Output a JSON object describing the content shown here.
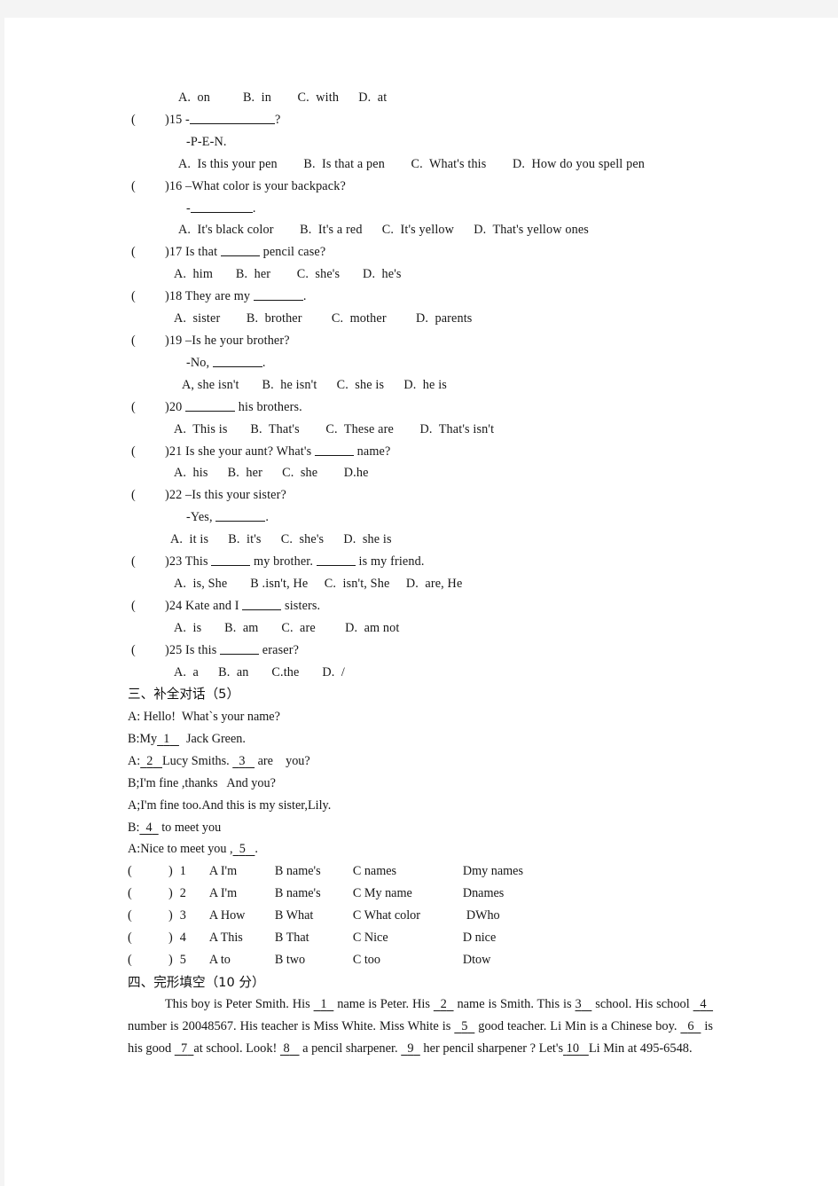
{
  "document": {
    "type": "english-exam-worksheet",
    "page_background": "#ffffff",
    "canvas_background": "#f4f4f4",
    "text_color": "#161616"
  },
  "section_two_tail": {
    "q14_options": "A.  on          B.  in        C.  with      D.  at",
    "questions": [
      {
        "num": "15",
        "paren_open": "(",
        "paren_close": ")",
        "stem_prefix": "15 -",
        "stem_suffix": "?",
        "sub_line": "-P-E-N.",
        "options": "A.  Is this your pen        B.  Is that a pen        C.  What's this        D.  How do you spell pen"
      },
      {
        "num": "16",
        "paren_open": "(",
        "paren_close": ")",
        "stem": "16 –What color is your backpack?",
        "sub_prefix": "-",
        "sub_suffix": ".",
        "options": "A.  It's black color        B.  It's a red      C.  It's yellow      D.  That's yellow ones"
      },
      {
        "num": "17",
        "paren_open": "(",
        "paren_close": ")",
        "stem_prefix": "17 Is that ",
        "stem_suffix": " pencil case?",
        "options": "A.  him       B.  her        C.  she's       D.  he's"
      },
      {
        "num": "18",
        "paren_open": "(",
        "paren_close": ")",
        "stem_prefix": "18 They are my ",
        "stem_suffix": ".",
        "options": "A.  sister        B.  brother         C.  mother         D.  parents"
      },
      {
        "num": "19",
        "paren_open": "(",
        "paren_close": ")",
        "stem": "19 –Is he your brother?",
        "sub_prefix": "-No, ",
        "sub_suffix": ".",
        "options": "A, she isn't       B.  he isn't      C.  she is      D.  he is"
      },
      {
        "num": "20",
        "paren_open": "(",
        "paren_close": ")",
        "stem_prefix": "20 ",
        "stem_suffix": " his brothers.",
        "options": "A.  This is       B.  That's        C.  These are        D.  That's isn't"
      },
      {
        "num": "21",
        "paren_open": "(",
        "paren_close": ")",
        "stem_prefix": "21 Is she your aunt? What's ",
        "stem_suffix": " name?",
        "options": "A.  his      B.  her      C.  she        D.he"
      },
      {
        "num": "22",
        "paren_open": "(",
        "paren_close": ")",
        "stem": "22 –Is this your sister?",
        "sub_prefix": "-Yes, ",
        "sub_suffix": ".",
        "options": "A.  it is      B.  it's      C.  she's      D.  she is"
      },
      {
        "num": "23",
        "paren_open": "(",
        "paren_close": ")",
        "stem_prefix": "23 This ",
        "stem_mid": " my brother. ",
        "stem_suffix": " is my friend.",
        "options": "A.  is, She       B .isn't, He     C.  isn't, She     D.  are, He"
      },
      {
        "num": "24",
        "paren_open": "(",
        "paren_close": ")",
        "stem_prefix": "24 Kate and I ",
        "stem_suffix": " sisters.",
        "options": "A.  is       B.  am       C.  are         D.  am not"
      },
      {
        "num": "25",
        "paren_open": "(",
        "paren_close": ")",
        "stem_prefix": "25 Is this ",
        "stem_suffix": " eraser?",
        "options": "A.  a      B.  an       C.the       D.  /"
      }
    ]
  },
  "section_three": {
    "heading": "三、补全对话（5）",
    "dialogue": [
      {
        "speaker_text": "A: Hello!  What`s your name?"
      },
      {
        "pre": "B:My",
        "blank": "1",
        "post": "Jack Green."
      },
      {
        "pre": "A:",
        "blank": "2",
        "mid": "Lucy Smiths. ",
        "blank2": "3",
        "post": " are    you?"
      },
      {
        "speaker_text": "B;I'm fine ,thanks   And you?"
      },
      {
        "speaker_text": "A;I'm fine too.And this is my sister,Lily."
      },
      {
        "pre": "B:",
        "blank": "4",
        "post": " to meet you"
      },
      {
        "pre": "A:Nice to meet you ,",
        "blank": "5",
        "post": "."
      }
    ],
    "options": [
      {
        "paren_open": "(",
        "paren_close": ")",
        "num": "1",
        "a": "A I'm",
        "b": "B name's",
        "c": "C names",
        "d": "Dmy names"
      },
      {
        "paren_open": "(",
        "paren_close": ")",
        "num": "2",
        "a": "A I'm",
        "b": "B name's",
        "c": "C My name",
        "d": "Dnames"
      },
      {
        "paren_open": "(",
        "paren_close": ")",
        "num": "3",
        "a": "A How",
        "b": "B What",
        "c": "C What color",
        "d": "DWho"
      },
      {
        "paren_open": "(",
        "paren_close": ")",
        "num": "4",
        "a": "A This",
        "b": "B That",
        "c": "C Nice",
        "d": "D nice"
      },
      {
        "paren_open": "(",
        "paren_close": ")",
        "num": "5",
        "a": "A to",
        "b": "B two",
        "c": "C too",
        "d": "Dtow"
      }
    ]
  },
  "section_four": {
    "heading": "四、完形填空（10 分）",
    "passage": {
      "t0": "This boy is Peter Smith. His ",
      "n1": "1",
      "t1": " name is Peter. His ",
      "n2": "2",
      "t2": " name is Smith. This is ",
      "n3": "3",
      "t3": " school. His school ",
      "n4": "4",
      "t4": " number is 20048567. His teacher is Miss White. Miss White is ",
      "n5": "5",
      "t5": " good teacher. Li Min is a Chinese boy. ",
      "n6": "6",
      "t6": " is his good ",
      "n7": "7",
      "t7": "at school. Look! ",
      "n8": "8",
      "t8": " a pencil sharpener. ",
      "n9": "9",
      "t9": " her pencil sharpener ? Let's",
      "n10": "10",
      "t10": "Li Min at 495-6548."
    }
  }
}
